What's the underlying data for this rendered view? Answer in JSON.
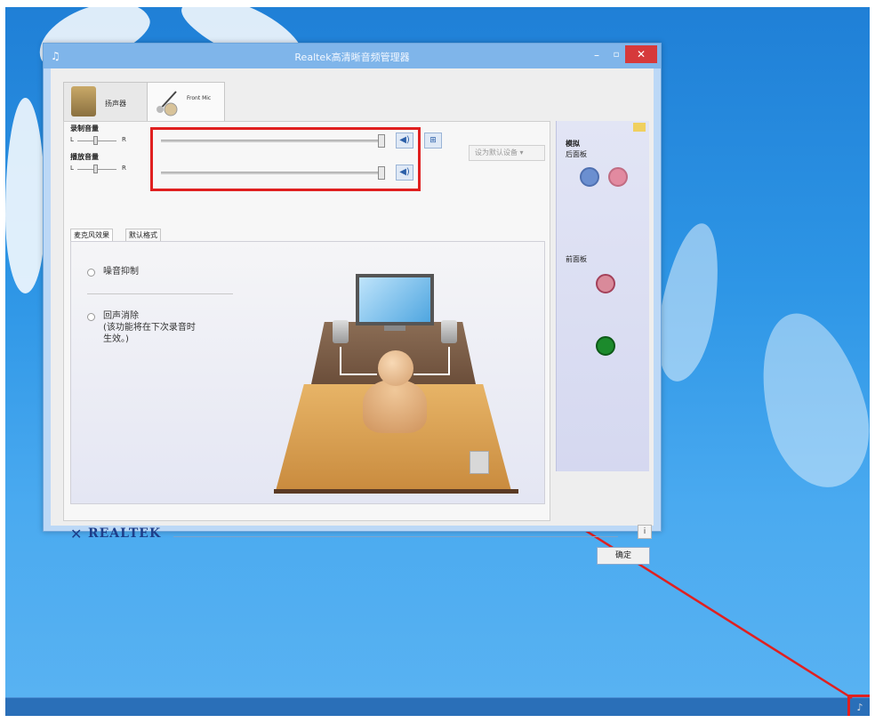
{
  "window": {
    "title": "Realtek高清晰音频管理器",
    "minimize": "–",
    "maximize": "▫",
    "close": "✕"
  },
  "device_tabs": [
    {
      "label": "扬声器"
    },
    {
      "label": "Front Mic"
    }
  ],
  "volume": {
    "record_label": "录制音量",
    "playback_label": "播放音量",
    "left": "L",
    "right": "R"
  },
  "set_default_button": "设为默认设备",
  "sub_tabs": [
    "麦克风效果",
    "默认格式"
  ],
  "options": {
    "noise_suppression": "噪音抑制",
    "echo_cancellation": "回声消除\n(该功能将在下次录音时\n生效。)"
  },
  "side_panel": {
    "title": "模拟",
    "back_panel": "后面板",
    "front_panel": "前面板"
  },
  "brand": "REALTEK",
  "info_button": "i",
  "ok_button": "确定",
  "colors": {
    "highlight": "#e02020",
    "jack_blue": "#6b8fd0",
    "jack_pink": "#e28aa0",
    "jack_green": "#1c8a2c"
  }
}
